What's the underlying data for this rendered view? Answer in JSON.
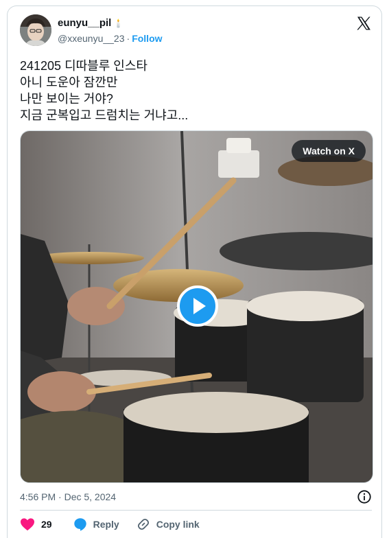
{
  "author": {
    "display_name": "eunyu__pil",
    "name_emoji": "🕯️",
    "handle": "@xxeunyu__23",
    "separator": "·",
    "follow_label": "Follow",
    "avatar_icon": "profile-photo"
  },
  "tweet": {
    "lines": [
      "241205 디따블루 인스타",
      "아니 도운아 잠깐만",
      "나만 보이는 거야?",
      "지금 군복입고 드럼치는 거냐고..."
    ]
  },
  "media": {
    "watch_label": "Watch on X",
    "play_icon": "play-icon",
    "type": "video"
  },
  "meta": {
    "timestamp": "4:56 PM · Dec 5, 2024"
  },
  "actions": {
    "like_count": "29",
    "reply_label": "Reply",
    "copy_link_label": "Copy link"
  },
  "colors": {
    "brand_blue": "#1d9bf0",
    "like_red": "#f91880",
    "text": "#0f1419",
    "secondary": "#536471",
    "border": "#cfd9de"
  }
}
